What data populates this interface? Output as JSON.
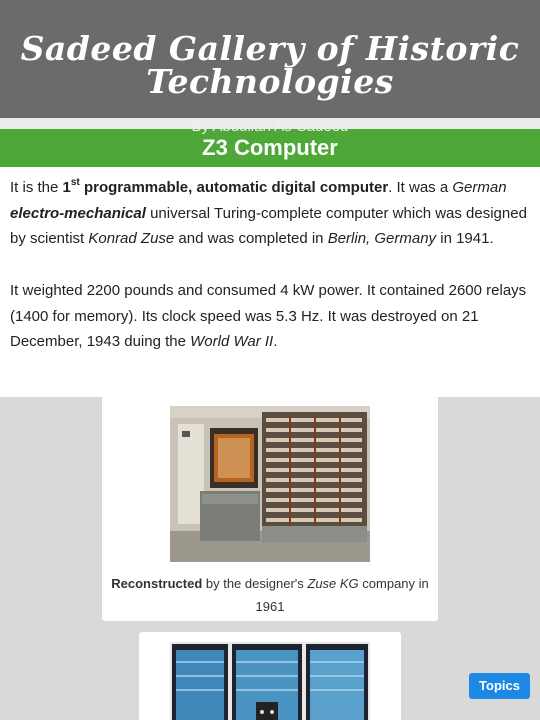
{
  "site": {
    "title": "Sadeed Gallery of Historic Technologies",
    "byline": "By Abdullah As-Sadeed"
  },
  "section": {
    "title": "Z3 Computer"
  },
  "article": {
    "p1": {
      "t1": "It is the ",
      "ordinal_num": "1",
      "ordinal_suffix": "st",
      "bold_phrase": " programmable, automatic digital computer",
      "t2": ". It was a ",
      "italic_1": "German",
      "space": " ",
      "bold_italic": "electro-mechanical",
      "t3": " universal Turing-complete computer which was designed by scientist ",
      "italic_2": "Konrad Zuse",
      "t4": " and was completed in ",
      "italic_3": "Berlin, Germany",
      "t5": " in 1941."
    },
    "p2": {
      "t1": "It weighted 2200 pounds and consumed 4 kW power. It contained 2600 relays (1400 for memory). Its clock speed was 5.3 Hz. It was destroyed on 21 December, 1943 duing the ",
      "italic": "World War II",
      "t2": "."
    }
  },
  "figure1": {
    "bold": "Reconstructed",
    "t1": " by the designer's ",
    "italic": "Zuse KG",
    "t2": " company in 1961"
  },
  "buttons": {
    "topics": "Topics"
  },
  "colors": {
    "header_bg": "#6b6b6b",
    "section_bg": "#4ea838",
    "topics_bg": "#1e88e5"
  }
}
